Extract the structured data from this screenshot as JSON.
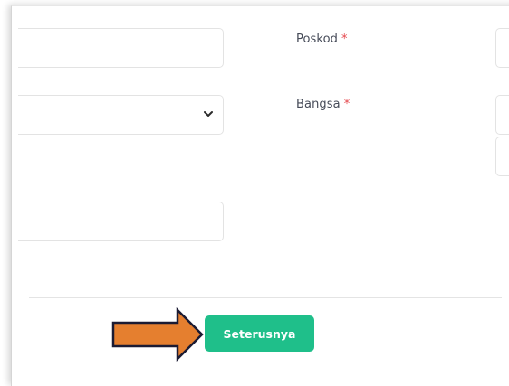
{
  "form": {
    "fields": [
      {
        "id": "field-1",
        "value": ""
      },
      {
        "id": "field-2-select",
        "value": ""
      },
      {
        "id": "field-3",
        "value": ""
      }
    ],
    "poskod_label": "Poskod",
    "bangsa_label": "Bangsa",
    "required_mark": "*"
  },
  "actions": {
    "next_label": "Seterusnya"
  },
  "colors": {
    "accent": "#1fbf8a",
    "required": "#e5484d",
    "arrow_fill": "#e57f2f",
    "arrow_stroke": "#1b1b33",
    "label_text": "#464b58"
  },
  "icons": {
    "select_chevron": "chevron-down-icon",
    "annotation_arrow": "arrow-right-icon"
  }
}
